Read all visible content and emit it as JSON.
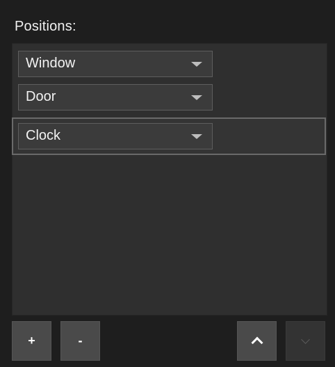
{
  "positions": {
    "label": "Positions:",
    "items": [
      {
        "value": "Window"
      },
      {
        "value": "Door"
      },
      {
        "value": "Clock"
      }
    ],
    "selected_index": 2
  },
  "toolbar": {
    "add_label": "+",
    "remove_label": "-",
    "move_up_icon": "chevron-up-icon",
    "move_down_icon": "chevron-down-icon",
    "move_down_enabled": false
  }
}
